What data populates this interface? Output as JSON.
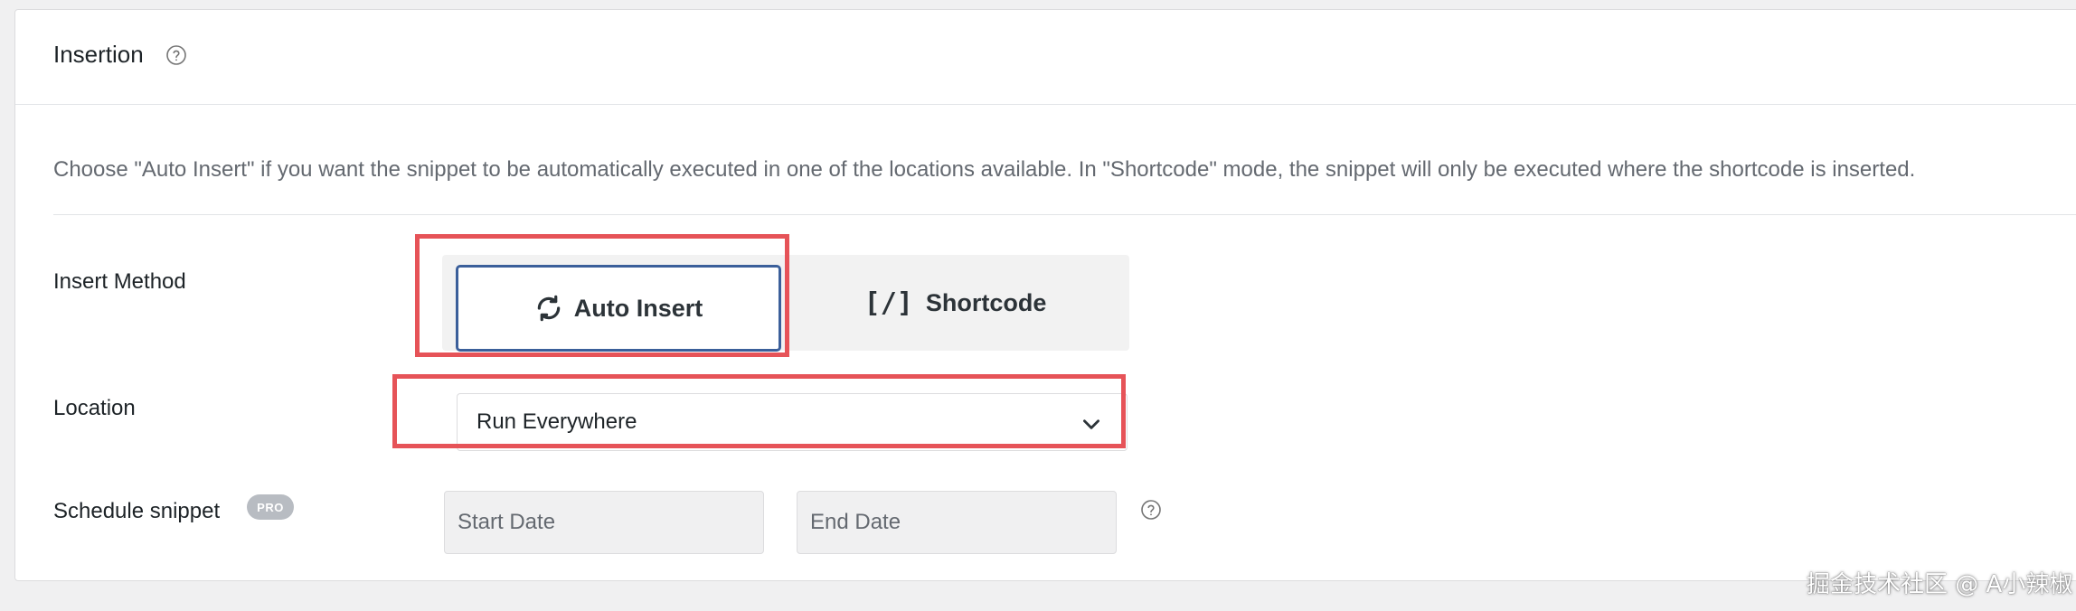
{
  "section": {
    "title": "Insertion",
    "description": "Choose \"Auto Insert\" if you want the snippet to be automatically executed in one of the locations available. In \"Shortcode\" mode, the snippet will only be executed where the shortcode is inserted."
  },
  "insert_method": {
    "label": "Insert Method",
    "options": [
      {
        "label": "Auto Insert",
        "icon": "refresh-icon",
        "selected": true
      },
      {
        "label": "Shortcode",
        "icon": "shortcode-icon",
        "icon_text": "[/]",
        "selected": false
      }
    ]
  },
  "location": {
    "label": "Location",
    "selected": "Run Everywhere"
  },
  "schedule": {
    "label": "Schedule snippet",
    "badge": "PRO",
    "start_placeholder": "Start Date",
    "end_placeholder": "End Date"
  },
  "watermark": "掘金技术社区 @ A小辣椒",
  "colors": {
    "highlight": "#e65358",
    "active_border": "#3b5f9a",
    "badge": "#b8bcc2"
  }
}
